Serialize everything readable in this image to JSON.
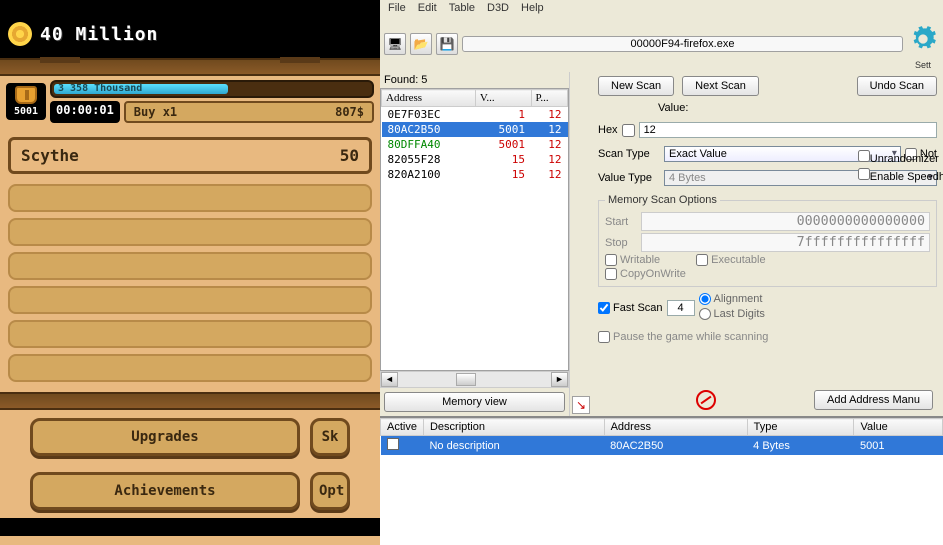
{
  "game": {
    "title": "40 Million",
    "coin_count": "5001",
    "progress_label": "3 358 Thousand",
    "timer": "00:00:01",
    "buy_label": "Buy x1",
    "buy_cost": "807$",
    "item_name": "Scythe",
    "item_value": "50",
    "btn_upgrades": "Upgrades",
    "btn_achievements": "Achievements",
    "btn_s": "Sk",
    "btn_opt": "Opt"
  },
  "ce": {
    "menu": [
      "File",
      "Edit",
      "Table",
      "D3D",
      "Help"
    ],
    "process": "00000F94-firefox.exe",
    "settings_label": "Sett",
    "found_label": "Found: 5",
    "addr_headers": [
      "Address",
      "V...",
      "P..."
    ],
    "addresses": [
      {
        "addr": "0E7F03EC",
        "v": "1",
        "p": "12",
        "sel": false,
        "g": false
      },
      {
        "addr": "80AC2B50",
        "v": "5001",
        "p": "12",
        "sel": true,
        "g": false
      },
      {
        "addr": "80DFFA40",
        "v": "5001",
        "p": "12",
        "sel": false,
        "g": true
      },
      {
        "addr": "82055F28",
        "v": "15",
        "p": "12",
        "sel": false,
        "g": false
      },
      {
        "addr": "820A2100",
        "v": "15",
        "p": "12",
        "sel": false,
        "g": false
      }
    ],
    "btn_newscan": "New Scan",
    "btn_nextscan": "Next Scan",
    "btn_undoscan": "Undo Scan",
    "value_label": "Value:",
    "hex_label": "Hex",
    "value_input": "12",
    "scantype_label": "Scan Type",
    "scantype_value": "Exact Value",
    "not_label": "Not",
    "valuetype_label": "Value Type",
    "valuetype_value": "4 Bytes",
    "memopts_label": "Memory Scan Options",
    "start_label": "Start",
    "start_value": "0000000000000000",
    "stop_label": "Stop",
    "stop_value": "7fffffffffffffff",
    "writable_label": "Writable",
    "exec_label": "Executable",
    "cow_label": "CopyOnWrite",
    "fastscan_label": "Fast Scan",
    "fastscan_value": "4",
    "alignment_label": "Alignment",
    "lastdigits_label": "Last Digits",
    "pause_label": "Pause the game while scanning",
    "unrandom_label": "Unrandomizer",
    "speedhack_label": "Enable Speedh",
    "btn_memview": "Memory view",
    "btn_addaddr": "Add Address Manu",
    "bt_headers": [
      "Active",
      "Description",
      "Address",
      "Type",
      "Value"
    ],
    "bt_row": {
      "desc": "No description",
      "addr": "80AC2B50",
      "type": "4 Bytes",
      "value": "5001"
    }
  }
}
